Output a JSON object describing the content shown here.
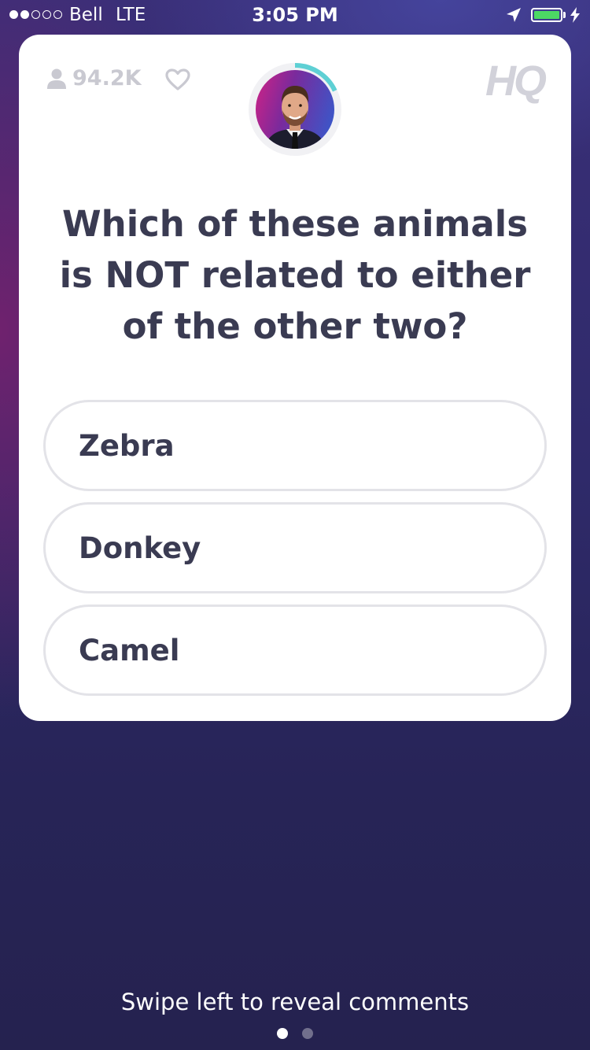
{
  "status_bar": {
    "carrier": "Bell",
    "network": "LTE",
    "time": "3:05 PM",
    "signal_bars_filled": 2,
    "signal_bars_total": 5,
    "battery_color": "#4cd964",
    "battery_level": 1.0
  },
  "header": {
    "viewer_count": "94.2K",
    "logo": "HQ",
    "host_timer_progress": 0.18,
    "timer_color": "#5ed0d4"
  },
  "question": {
    "text": "Which of these animals is NOT related to either of the other two?"
  },
  "answers": [
    {
      "label": "Zebra"
    },
    {
      "label": "Donkey"
    },
    {
      "label": "Camel"
    }
  ],
  "footer": {
    "hint": "Swipe left to reveal comments",
    "pages": 2,
    "active_page": 0
  },
  "icons": [
    "user-icon",
    "heart-icon",
    "location-arrow-icon",
    "battery-icon",
    "charging-bolt-icon"
  ]
}
